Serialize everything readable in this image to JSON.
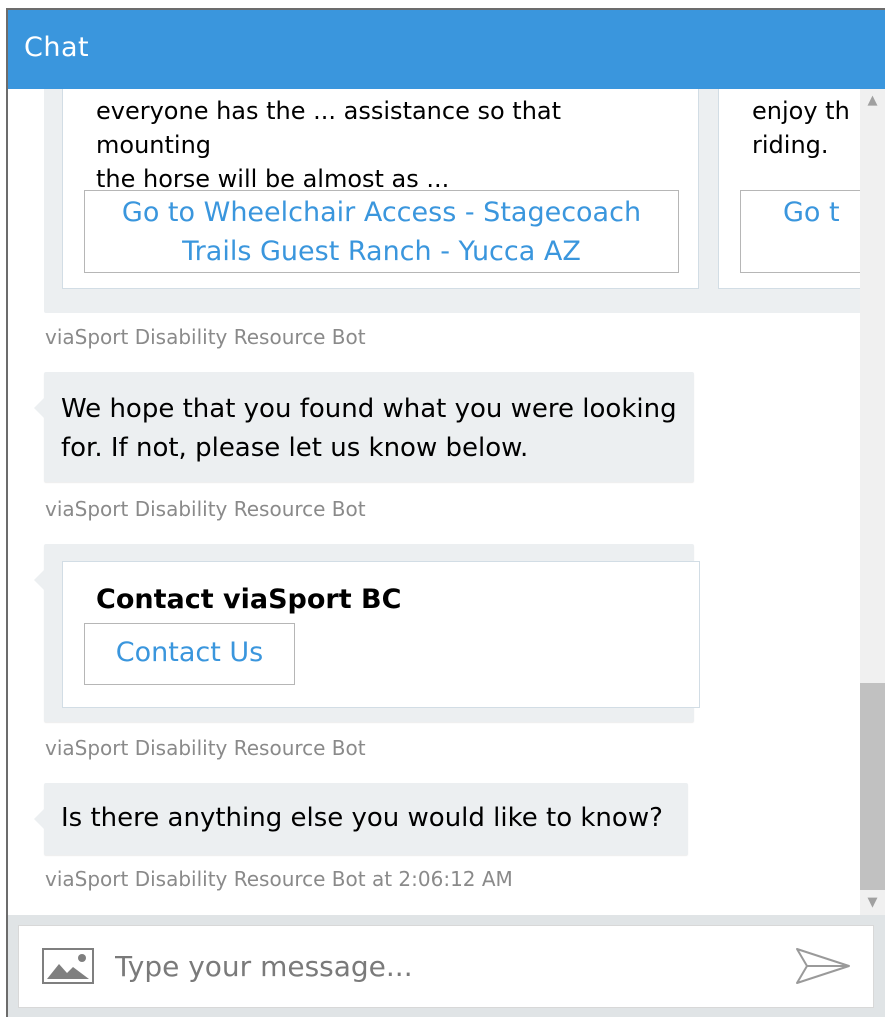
{
  "header": {
    "title": "Chat"
  },
  "carousel": {
    "cards": [
      {
        "text_line1": "everyone has the ... assistance so that mounting",
        "text_line2": "the horse will be almost as ...",
        "button_line1": "Go to Wheelchair Access - Stagecoach",
        "button_line2": "Trails Guest Ranch - Yucca AZ"
      },
      {
        "text_line1": "enjoy th",
        "text_line2": "riding.",
        "button_line1": "Go t",
        "button_line2": ""
      }
    ]
  },
  "messages": [
    {
      "sender": "viaSport Disability Resource Bot"
    },
    {
      "text": "We hope that you found what you were looking for. If not, please let us know below.",
      "sender": "viaSport Disability Resource Bot"
    },
    {
      "card_title": "Contact viaSport BC",
      "button": "Contact Us",
      "sender": "viaSport Disability Resource Bot"
    },
    {
      "text": "Is there anything else you would like to know?",
      "sender": "viaSport Disability Resource Bot at 2:06:12 AM"
    }
  ],
  "input": {
    "placeholder": "Type your message...",
    "value": ""
  },
  "icons": {
    "upload": "image-upload-icon",
    "send": "send-icon",
    "scroll_up": "chevron-up-icon",
    "scroll_down": "chevron-down-icon"
  },
  "colors": {
    "accent": "#3a96dd",
    "bubble": "#eceff1",
    "input_bar": "#e0e4e6"
  }
}
